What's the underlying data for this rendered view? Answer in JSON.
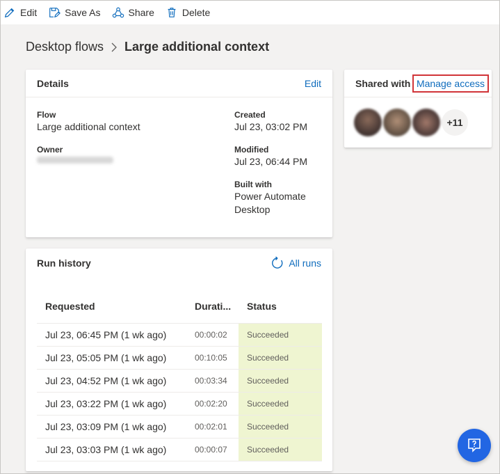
{
  "toolbar": {
    "edit_label": "Edit",
    "save_as_label": "Save As",
    "share_label": "Share",
    "delete_label": "Delete",
    "accent": "#0f6cbd"
  },
  "breadcrumb": {
    "parent": "Desktop flows",
    "current": "Large additional context"
  },
  "details": {
    "title": "Details",
    "edit_link": "Edit",
    "flow_label": "Flow",
    "flow_value": "Large additional context",
    "owner_label": "Owner",
    "created_label": "Created",
    "created_value": "Jul 23, 03:02 PM",
    "modified_label": "Modified",
    "modified_value": "Jul 23, 06:44 PM",
    "built_with_label": "Built with",
    "built_with_value_line1": "Power Automate",
    "built_with_value_line2": "Desktop"
  },
  "shared": {
    "title": "Shared with",
    "manage_link": "Manage access",
    "extra_count": "+11",
    "highlight_color": "#d13438"
  },
  "runs": {
    "title": "Run history",
    "all_runs_link": "All runs",
    "columns": [
      "Requested",
      "Durati...",
      "Status"
    ],
    "rows": [
      {
        "requested": "Jul 23, 06:45 PM (1 wk ago)",
        "duration": "00:00:02",
        "status": "Succeeded"
      },
      {
        "requested": "Jul 23, 05:05 PM (1 wk ago)",
        "duration": "00:10:05",
        "status": "Succeeded"
      },
      {
        "requested": "Jul 23, 04:52 PM (1 wk ago)",
        "duration": "00:03:34",
        "status": "Succeeded"
      },
      {
        "requested": "Jul 23, 03:22 PM (1 wk ago)",
        "duration": "00:02:20",
        "status": "Succeeded"
      },
      {
        "requested": "Jul 23, 03:09 PM (1 wk ago)",
        "duration": "00:02:01",
        "status": "Succeeded"
      },
      {
        "requested": "Jul 23, 03:03 PM (1 wk ago)",
        "duration": "00:00:07",
        "status": "Succeeded"
      }
    ],
    "status_bg": "#eff5d1"
  },
  "fab": {
    "icon": "feedback-icon",
    "color": "#2266e3"
  }
}
